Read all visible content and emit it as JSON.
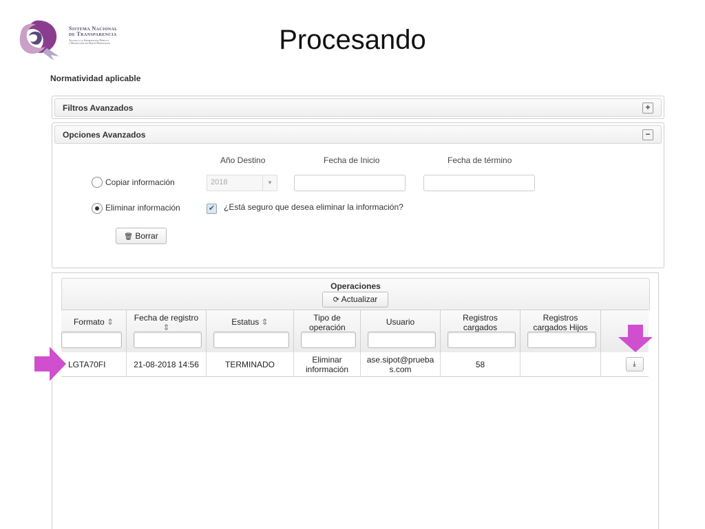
{
  "logo": {
    "line1": "Sistema Nacional",
    "line2": "de Transparencia",
    "line3": "Acceso a la Información Pública",
    "line4": "y Protección de Datos Personales",
    "colors": [
      "#8a3d8f",
      "#c9a0c8",
      "#5a4a7a"
    ]
  },
  "slide_title": "Procesando",
  "section_label": "Normatividad aplicable",
  "filtros": {
    "title": "Filtros Avanzados",
    "toggle": "+"
  },
  "opciones": {
    "title": "Opciones Avanzados",
    "toggle": "−",
    "col_anio": "Año Destino",
    "col_inicio": "Fecha de Inicio",
    "col_termino": "Fecha de término",
    "copiar_label": "Copiar información",
    "eliminar_label": "Eliminar información",
    "anio_value": "2018",
    "confirm_label": "¿Está seguro que desea eliminar la información?",
    "confirm_checked": true,
    "borrar_label": "Borrar"
  },
  "operaciones": {
    "title": "Operaciones",
    "actualizar_label": "Actualizar",
    "columns": [
      {
        "label": "Formato",
        "sort": "⇕"
      },
      {
        "label": "Fecha de registro",
        "sort": "⇕"
      },
      {
        "label": "Estatus",
        "sort": "⇕"
      },
      {
        "label": "Tipo de operación",
        "sort": ""
      },
      {
        "label": "Usuario",
        "sort": ""
      },
      {
        "label": "Registros cargados",
        "sort": ""
      },
      {
        "label": "Registros cargados Hijos",
        "sort": ""
      },
      {
        "label": "",
        "sort": ""
      }
    ],
    "rows": [
      {
        "formato": "LGTA70FI",
        "fecha": "21-08-2018 14:56",
        "estatus": "TERMINADO",
        "tipo": "Eliminar información",
        "usuario": "ase.sipot@pruebas.com",
        "registros": "58",
        "hijos": "",
        "download_icon": "download-icon"
      }
    ]
  },
  "accent_arrow_color": "#d04fcf"
}
